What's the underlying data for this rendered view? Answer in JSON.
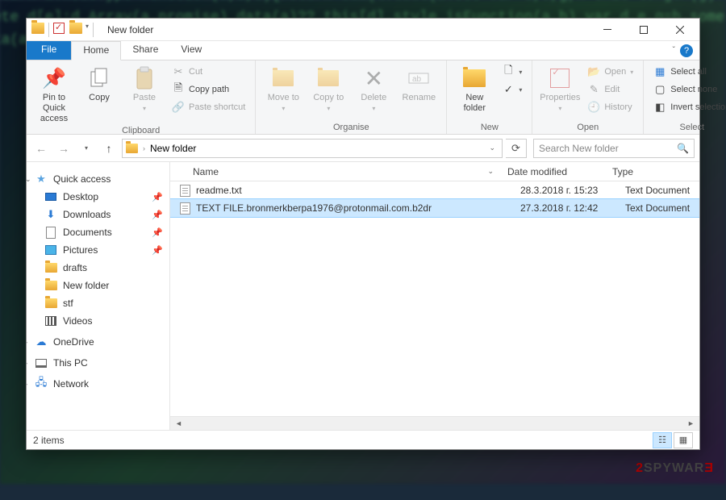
{
  "window": {
    "title": "New folder"
  },
  "tabs": {
    "file": "File",
    "home": "Home",
    "share": "Share",
    "view": "View"
  },
  "ribbon": {
    "clipboard": {
      "label": "Clipboard",
      "pin": "Pin to Quick access",
      "copy": "Copy",
      "paste": "Paste",
      "cut": "Cut",
      "copypath": "Copy path",
      "shortcut": "Paste shortcut"
    },
    "organise": {
      "label": "Organise",
      "moveto": "Move to",
      "copyto": "Copy to",
      "delete": "Delete",
      "rename": "Rename"
    },
    "new": {
      "label": "New",
      "newfolder": "New folder"
    },
    "open": {
      "label": "Open",
      "properties": "Properties",
      "open": "Open",
      "edit": "Edit",
      "history": "History"
    },
    "select": {
      "label": "Select",
      "all": "Select all",
      "none": "Select none",
      "invert": "Invert selection"
    }
  },
  "address": {
    "crumb1": "New folder"
  },
  "search": {
    "placeholder": "Search New folder"
  },
  "sidebar": {
    "quick": "Quick access",
    "desktop": "Desktop",
    "downloads": "Downloads",
    "documents": "Documents",
    "pictures": "Pictures",
    "drafts": "drafts",
    "newfolder": "New folder",
    "stf": "stf",
    "videos": "Videos",
    "onedrive": "OneDrive",
    "thispc": "This PC",
    "network": "Network"
  },
  "columns": {
    "name": "Name",
    "date": "Date modified",
    "type": "Type"
  },
  "files": [
    {
      "name": "readme.txt",
      "date": "28.3.2018 г. 15:23",
      "type": "Text Document"
    },
    {
      "name": "TEXT FILE.bronmerkberpa1976@protonmail.com.b2dr",
      "date": "27.3.2018 г. 12:42",
      "type": "Text Document"
    }
  ],
  "status": {
    "items": "2 items"
  },
  "watermark": {
    "brand_one": "2",
    "brand_two": "SPYWAR",
    "brand_three": "Ǝ"
  }
}
